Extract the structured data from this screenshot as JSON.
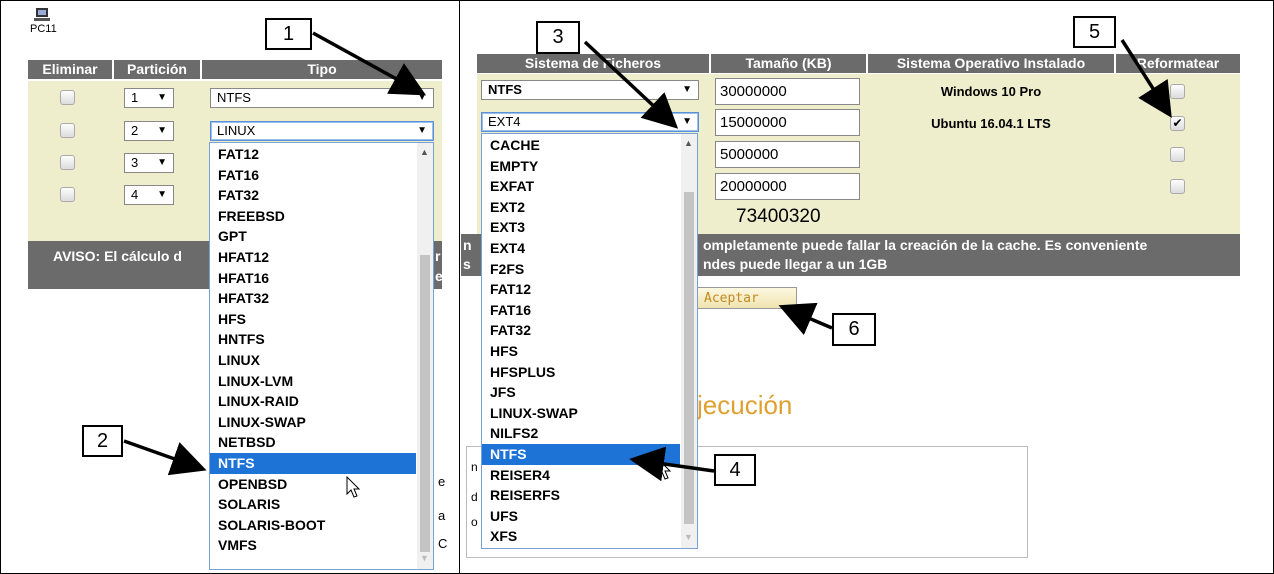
{
  "left": {
    "pc_label": "PC11",
    "headers": {
      "delete": "Eliminar",
      "partition": "Partición",
      "type": "Tipo"
    },
    "rows": [
      {
        "partition": "1",
        "type": "NTFS"
      },
      {
        "partition": "2",
        "type": "LINUX"
      },
      {
        "partition": "3"
      },
      {
        "partition": "4"
      }
    ],
    "warning": "AVISO: El cálculo d",
    "warning_tail": [
      "r",
      "e"
    ],
    "dropdown_options": [
      "FAT12",
      "FAT16",
      "FAT32",
      "FREEBSD",
      "GPT",
      "HFAT12",
      "HFAT16",
      "HFAT32",
      "HFS",
      "HNTFS",
      "LINUX",
      "LINUX-LVM",
      "LINUX-RAID",
      "LINUX-SWAP",
      "NETBSD",
      "NTFS",
      "OPENBSD",
      "SOLARIS",
      "SOLARIS-BOOT",
      "VMFS"
    ],
    "dropdown_highlight": "NTFS",
    "side_letters": [
      "e",
      "a",
      "C"
    ]
  },
  "right": {
    "headers": {
      "fs": "Sistema de Ficheros",
      "size": "Tamaño (KB)",
      "os": "Sistema Operativo Instalado",
      "reformat": "Reformatear"
    },
    "rows": [
      {
        "fs": "NTFS",
        "size": "30000000",
        "os": "Windows 10 Pro",
        "reformat": false
      },
      {
        "fs": "EXT4",
        "size": "15000000",
        "os": "Ubuntu 16.04.1 LTS",
        "reformat": true
      },
      {
        "size": "5000000",
        "os": "",
        "reformat": false
      },
      {
        "size": "20000000",
        "os": "",
        "reformat": false
      }
    ],
    "total": "73400320",
    "warning_line1": "ompletamente puede fallar la creación de la cache. Es conveniente",
    "warning_line2": "ndes puede llegar a un 1GB",
    "warning_left": [
      "n",
      "s"
    ],
    "accept_button": "Aceptar",
    "section_title": "jecución",
    "side_letters": [
      "n",
      "d",
      "o"
    ],
    "dropdown_options": [
      "CACHE",
      "EMPTY",
      "EXFAT",
      "EXT2",
      "EXT3",
      "EXT4",
      "F2FS",
      "FAT12",
      "FAT16",
      "FAT32",
      "HFS",
      "HFSPLUS",
      "JFS",
      "LINUX-SWAP",
      "NILFS2",
      "NTFS",
      "REISER4",
      "REISERFS",
      "UFS",
      "XFS"
    ],
    "dropdown_highlight": "NTFS"
  },
  "callouts": [
    "1",
    "2",
    "3",
    "4",
    "5",
    "6"
  ],
  "colors": {
    "header": "#6b6b6b",
    "row": "#eeeecc",
    "highlight": "#1e73d6",
    "title": "#e0a030"
  }
}
